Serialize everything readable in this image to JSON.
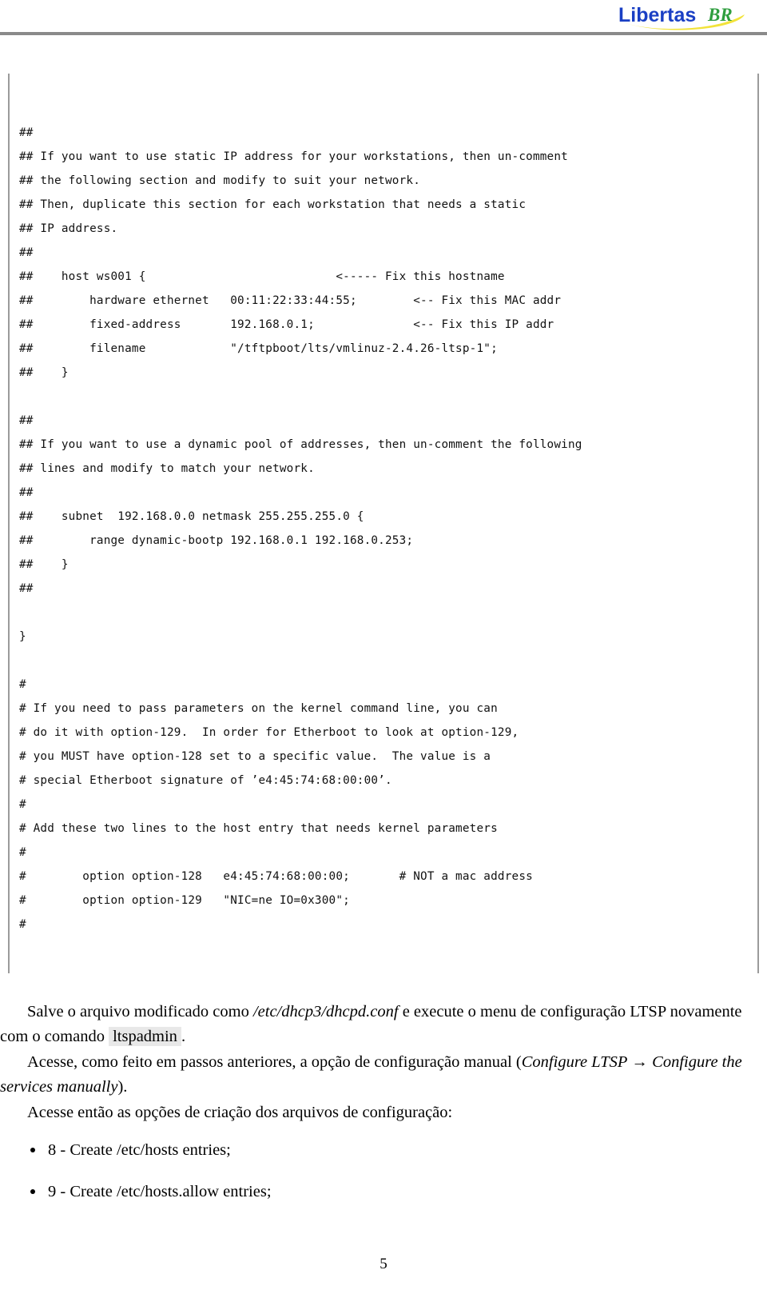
{
  "header": {
    "logo_text_main": "Libertas",
    "logo_text_suffix": "BR",
    "logo_color_main": "#1a3fc4",
    "logo_color_suffix": "#2f9e3f",
    "logo_swoosh_color": "#f2e33a",
    "rule_color": "#8a8a8a"
  },
  "code_block": {
    "lines": [
      "##",
      "## If you want to use static IP address for your workstations, then un-comment",
      "## the following section and modify to suit your network.",
      "## Then, duplicate this section for each workstation that needs a static",
      "## IP address.",
      "##",
      "##    host ws001 {                           <----- Fix this hostname",
      "##        hardware ethernet   00:11:22:33:44:55;        <-- Fix this MAC addr",
      "##        fixed-address       192.168.0.1;              <-- Fix this IP addr",
      "##        filename            \"/tftpboot/lts/vmlinuz-2.4.26-ltsp-1\";",
      "##    }",
      "",
      "##",
      "## If you want to use a dynamic pool of addresses, then un-comment the following",
      "## lines and modify to match your network.",
      "##",
      "##    subnet  192.168.0.0 netmask 255.255.255.0 {",
      "##        range dynamic-bootp 192.168.0.1 192.168.0.253;",
      "##    }",
      "##",
      "",
      "}",
      "",
      "#",
      "# If you need to pass parameters on the kernel command line, you can",
      "# do it with option-129.  In order for Etherboot to look at option-129,",
      "# you MUST have option-128 set to a specific value.  The value is a",
      "# special Etherboot signature of ’e4:45:74:68:00:00’.",
      "#",
      "# Add these two lines to the host entry that needs kernel parameters",
      "#",
      "#        option option-128   e4:45:74:68:00:00;       # NOT a mac address",
      "#        option option-129   \"NIC=ne IO=0x300\";",
      "#"
    ]
  },
  "prose": {
    "paragraph_1": {
      "part_1": "Salve o arquivo modificado como ",
      "file_path": "/etc/dhcp3/dhcpd.conf",
      "part_2": " e execute o menu de configuração LTSP novamente com o comando ",
      "command": "ltspadmin",
      "part_3": "."
    },
    "paragraph_2": {
      "part_1": "Acesse, como feito em passos anteriores, a opção de configuração manual (",
      "menu_path_1": "Configure LTSP",
      "arrow": " → ",
      "menu_path_2": "Configure the services manually",
      "part_2": ")."
    },
    "paragraph_3": {
      "text": "Acesse então as opções de criação dos arquivos de configuração:"
    },
    "bullets": [
      "8 - Create /etc/hosts entries;",
      "9 - Create /etc/hosts.allow entries;"
    ]
  },
  "footer": {
    "page_number": "5"
  }
}
